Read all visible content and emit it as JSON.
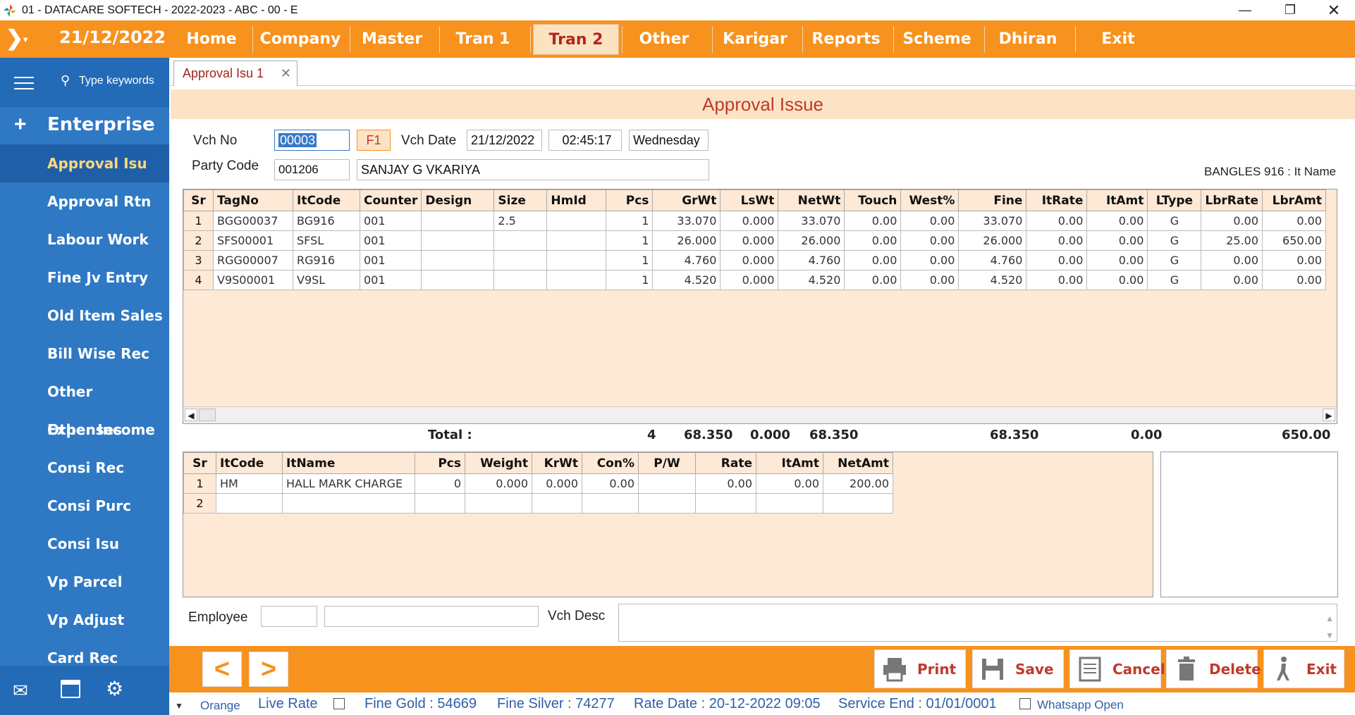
{
  "window": {
    "title": "01 - DATACARE SOFTECH - 2022-2023 - ABC - 00 - E"
  },
  "menubar": {
    "date": "21/12/2022",
    "items": [
      "Home",
      "Company",
      "Master",
      "Tran 1",
      "Tran 2",
      "Other",
      "Karigar",
      "Reports",
      "Scheme",
      "Dhiran",
      "Exit"
    ],
    "active": "Tran 2"
  },
  "sidebar": {
    "search_placeholder": "Type keywords",
    "section": "Enterprise",
    "items": [
      "Approval Isu",
      "Approval Rtn",
      "Labour Work",
      "Fine Jv Entry",
      "Old Item Sales",
      "Bill Wise Rec",
      "Other Expenses",
      "Other Income",
      "Consi Rec",
      "Consi Purc",
      "Consi Isu",
      "Vp Parcel",
      "Vp Adjust",
      "Card Rec"
    ]
  },
  "tab": {
    "label": "Approval Isu 1"
  },
  "form": {
    "title": "Approval Issue",
    "vch_no_label": "Vch No",
    "vch_no": "00003",
    "f1": "F1",
    "vch_date_label": "Vch Date",
    "vch_date": "21/12/2022",
    "time": "02:45:17",
    "day": "Wednesday",
    "party_code_label": "Party Code",
    "party_code": "001206",
    "party_name": "SANJAY G VKARIYA",
    "item_info": "BANGLES 916 : It Name"
  },
  "main_grid": {
    "columns": [
      "Sr",
      "TagNo",
      "ItCode",
      "Counter",
      "Design",
      "Size",
      "HmId",
      "Pcs",
      "GrWt",
      "LsWt",
      "NetWt",
      "Touch",
      "West%",
      "Fine",
      "ItRate",
      "ItAmt",
      "LType",
      "LbrRate",
      "LbrAmt"
    ],
    "rows": [
      [
        "1",
        "BGG00037",
        "BG916",
        "001",
        "",
        "2.5",
        "",
        "1",
        "33.070",
        "0.000",
        "33.070",
        "0.00",
        "0.00",
        "33.070",
        "0.00",
        "0.00",
        "G",
        "0.00",
        "0.00"
      ],
      [
        "2",
        "SFS00001",
        "SFSL",
        "001",
        "",
        "",
        "",
        "1",
        "26.000",
        "0.000",
        "26.000",
        "0.00",
        "0.00",
        "26.000",
        "0.00",
        "0.00",
        "G",
        "25.00",
        "650.00"
      ],
      [
        "3",
        "RGG00007",
        "RG916",
        "001",
        "",
        "",
        "",
        "1",
        "4.760",
        "0.000",
        "4.760",
        "0.00",
        "0.00",
        "4.760",
        "0.00",
        "0.00",
        "G",
        "0.00",
        "0.00"
      ],
      [
        "4",
        "V9S00001",
        "V9SL",
        "001",
        "",
        "",
        "",
        "1",
        "4.520",
        "0.000",
        "4.520",
        "0.00",
        "0.00",
        "4.520",
        "0.00",
        "0.00",
        "G",
        "0.00",
        "0.00"
      ]
    ]
  },
  "totals": {
    "label": "Total :",
    "pcs": "4",
    "grwt": "68.350",
    "lswt": "0.000",
    "netwt": "68.350",
    "fine": "68.350",
    "itamt": "0.00",
    "lbramt": "650.00"
  },
  "charge_grid": {
    "columns": [
      "Sr",
      "ItCode",
      "ItName",
      "Pcs",
      "Weight",
      "KrWt",
      "Con%",
      "P/W",
      "Rate",
      "ItAmt",
      "NetAmt"
    ],
    "rows": [
      [
        "1",
        "HM",
        "HALL MARK CHARGE",
        "0",
        "0.000",
        "0.000",
        "0.00",
        "",
        "0.00",
        "0.00",
        "200.00"
      ],
      [
        "2",
        "",
        "",
        "",
        "",
        "",
        "",
        "",
        "",
        "",
        ""
      ]
    ]
  },
  "footer_form": {
    "employee_label": "Employee",
    "vch_desc_label": "Vch Desc"
  },
  "actions": {
    "prev": "<",
    "next": ">",
    "print": "Print",
    "save": "Save",
    "cancel": "Cancel",
    "delete": "Delete",
    "exit": "Exit"
  },
  "status": {
    "theme": "Orange",
    "live_rate": "Live Rate",
    "fine_gold": "Fine Gold : 54669",
    "fine_silver": "Fine Silver : 74277",
    "rate_date": "Rate Date : 20-12-2022 09:05",
    "service_end": "Service End :  01/01/0001",
    "whatsapp": "Whatsapp Open"
  },
  "colors": {
    "accent": "#f7921e",
    "sidebar": "#2f78c4",
    "title_red": "#c0392b",
    "grid_bg": "#fde9d6"
  }
}
